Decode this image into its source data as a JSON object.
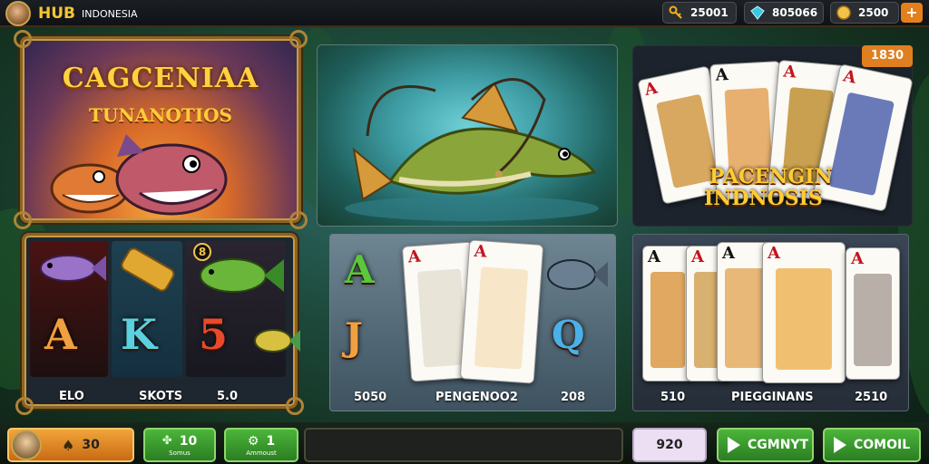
{
  "header": {
    "brand": "HUB",
    "brand_sub": "INDONESIA",
    "balance_1": "25001",
    "balance_2": "805066",
    "balance_3": "2500",
    "add_label": "+"
  },
  "logo_panel": {
    "title_line1": "CAGCENIAA",
    "title_line2": "TUNANOTIOS"
  },
  "slot_panel": {
    "reel_symbols": [
      "A",
      "K",
      "5"
    ],
    "coin_badge": "8",
    "bottom_labels": [
      "ELO",
      "SKOTS",
      "5.0"
    ]
  },
  "middle_panel": {
    "symbols": [
      "A",
      "J",
      "Q"
    ],
    "cards": [
      {
        "rank": "A"
      },
      {
        "rank": "A"
      }
    ],
    "bottom_labels": [
      "5050",
      "PENGENOO2",
      "208"
    ]
  },
  "right_panel": {
    "badge": "1830",
    "title_line1": "PACENGIN",
    "title_line2": "INDNOSIS",
    "cards_top": [
      "A",
      "A",
      "A",
      "A"
    ],
    "cards_bottom": [
      "A",
      "A",
      "A",
      "A",
      "A"
    ],
    "bottom_labels": [
      "510",
      "PIEGGINANS",
      "2510"
    ]
  },
  "footer": {
    "lives": "30",
    "btn1_value": "10",
    "btn1_sub": "Somus",
    "btn2_value": "1",
    "btn2_sub": "Ammoust",
    "bet_value": "920",
    "count_label": "CGMNYT",
    "control_label": "COMOIL"
  },
  "colors": {
    "gold": "#f6c531",
    "accent_orange": "#e07f1f",
    "button_green": "#3a9a2e",
    "card_red": "#c2141f"
  }
}
